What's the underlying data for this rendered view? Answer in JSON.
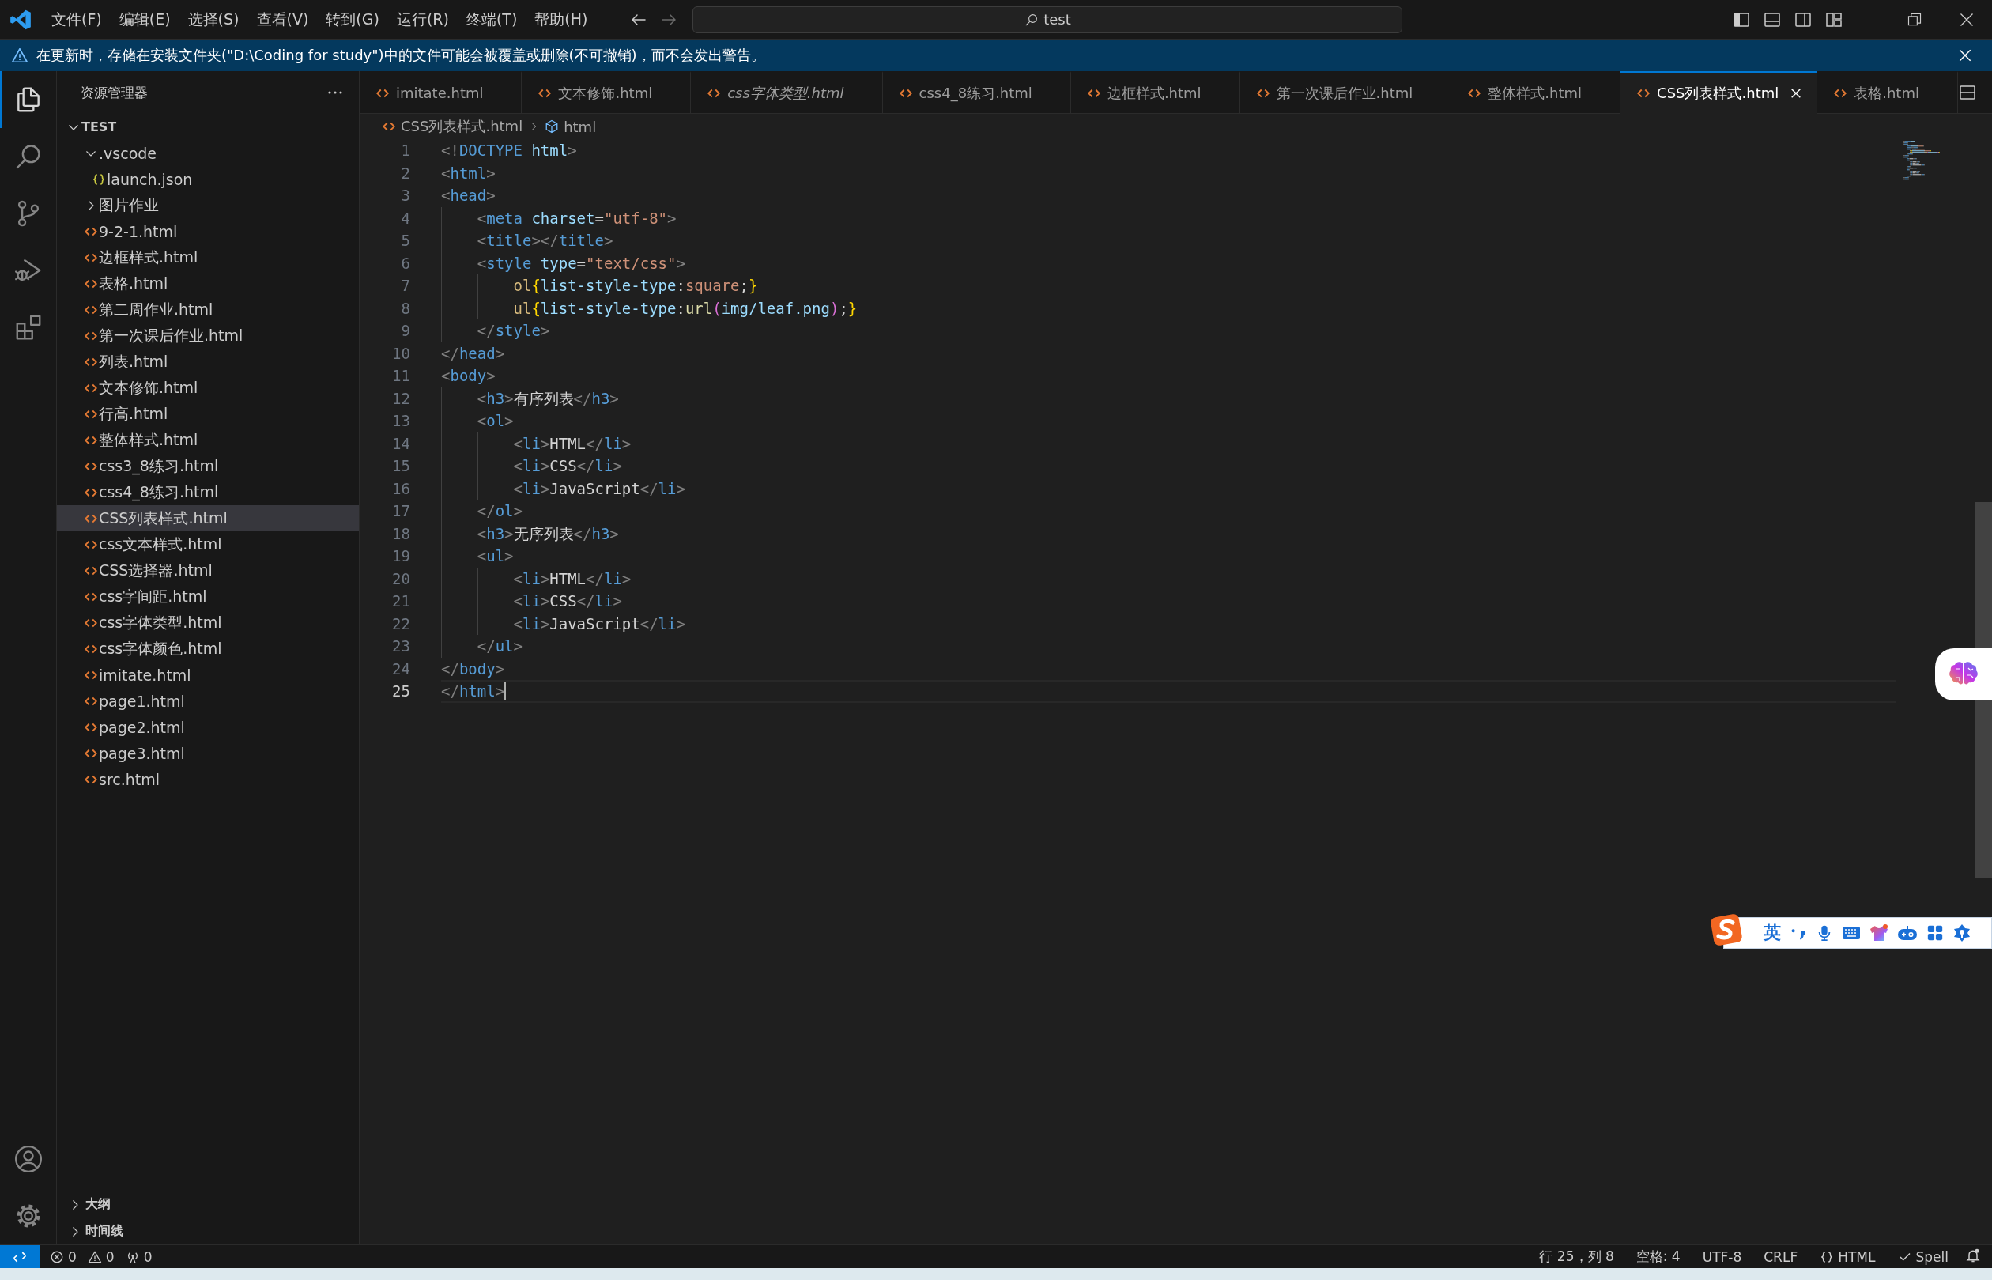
{
  "title_bar": {
    "menu": [
      "文件(F)",
      "编辑(E)",
      "选择(S)",
      "查看(V)",
      "转到(G)",
      "运行(R)",
      "终端(T)",
      "帮助(H)"
    ],
    "command_center": "test"
  },
  "notification": {
    "message": "在更新时，存储在安装文件夹(\"D:\\Coding for study\")中的文件可能会被覆盖或删除(不可撤销)，而不会发出警告。"
  },
  "activity_bar": {
    "top": [
      {
        "kind": "explorer",
        "selected": true
      },
      {
        "kind": "search",
        "selected": false
      },
      {
        "kind": "scm",
        "selected": false
      },
      {
        "kind": "debug",
        "selected": false
      },
      {
        "kind": "extensions",
        "selected": false
      }
    ],
    "bottom": [
      {
        "kind": "accounts"
      },
      {
        "kind": "manage"
      }
    ]
  },
  "explorer": {
    "title": "资源管理器",
    "root": {
      "label": "TEST",
      "expanded": true,
      "children": [
        {
          "label": ".vscode",
          "kind": "folder",
          "expanded": true,
          "selected": false,
          "children": [
            {
              "label": "launch.json",
              "kind": "json",
              "selected": false
            }
          ]
        },
        {
          "label": "图片作业",
          "kind": "folder",
          "expanded": false,
          "selected": false
        },
        {
          "label": "9-2-1.html",
          "kind": "html",
          "selected": false
        },
        {
          "label": "边框样式.html",
          "kind": "html",
          "selected": false
        },
        {
          "label": "表格.html",
          "kind": "html",
          "selected": false
        },
        {
          "label": "第二周作业.html",
          "kind": "html",
          "selected": false
        },
        {
          "label": "第一次课后作业.html",
          "kind": "html",
          "selected": false
        },
        {
          "label": "列表.html",
          "kind": "html",
          "selected": false
        },
        {
          "label": "文本修饰.html",
          "kind": "html",
          "selected": false
        },
        {
          "label": "行高.html",
          "kind": "html",
          "selected": false
        },
        {
          "label": "整体样式.html",
          "kind": "html",
          "selected": false
        },
        {
          "label": "css3_8练习.html",
          "kind": "html",
          "selected": false
        },
        {
          "label": "css4_8练习.html",
          "kind": "html",
          "selected": false
        },
        {
          "label": "CSS列表样式.html",
          "kind": "html",
          "selected": true
        },
        {
          "label": "css文本样式.html",
          "kind": "html",
          "selected": false
        },
        {
          "label": "CSS选择器.html",
          "kind": "html",
          "selected": false
        },
        {
          "label": "css字间距.html",
          "kind": "html",
          "selected": false
        },
        {
          "label": "css字体类型.html",
          "kind": "html",
          "selected": false
        },
        {
          "label": "css字体颜色.html",
          "kind": "html",
          "selected": false
        },
        {
          "label": "imitate.html",
          "kind": "html",
          "selected": false
        },
        {
          "label": "page1.html",
          "kind": "html",
          "selected": false
        },
        {
          "label": "page2.html",
          "kind": "html",
          "selected": false
        },
        {
          "label": "page3.html",
          "kind": "html",
          "selected": false
        },
        {
          "label": "src.html",
          "kind": "html",
          "selected": false
        }
      ]
    },
    "sections": [
      {
        "label": "大纲",
        "expanded": false
      },
      {
        "label": "时间线",
        "expanded": false
      }
    ]
  },
  "tabs": [
    {
      "label": "imitate.html",
      "selected": false,
      "preview": false
    },
    {
      "label": "文本修饰.html",
      "selected": false,
      "preview": false
    },
    {
      "label": "css字体类型.html",
      "selected": false,
      "preview": true
    },
    {
      "label": "css4_8练习.html",
      "selected": false,
      "preview": false
    },
    {
      "label": "边框样式.html",
      "selected": false,
      "preview": false
    },
    {
      "label": "第一次课后作业.html",
      "selected": false,
      "preview": false
    },
    {
      "label": "整体样式.html",
      "selected": false,
      "preview": false
    },
    {
      "label": "CSS列表样式.html",
      "selected": true,
      "preview": false
    },
    {
      "label": "表格.html",
      "selected": false,
      "preview": false
    }
  ],
  "breadcrumb": [
    "CSS列表样式.html",
    "html"
  ],
  "lines": [
    {
      "number": "1",
      "current": false,
      "tokens": [
        {
          "kind": "p",
          "text": "<!"
        },
        {
          "kind": "tag",
          "text": "DOCTYPE"
        },
        {
          "kind": "attr",
          "text": " html"
        },
        {
          "kind": "p",
          "text": ">"
        }
      ]
    },
    {
      "number": "2",
      "current": false,
      "tokens": [
        {
          "kind": "p",
          "text": "<"
        },
        {
          "kind": "tag",
          "text": "html"
        },
        {
          "kind": "p",
          "text": ">"
        }
      ]
    },
    {
      "number": "3",
      "current": false,
      "tokens": [
        {
          "kind": "p",
          "text": "<"
        },
        {
          "kind": "tag",
          "text": "head"
        },
        {
          "kind": "p",
          "text": ">"
        }
      ]
    },
    {
      "number": "4",
      "current": false,
      "tokens": [
        {
          "kind": "p",
          "text": "    <"
        },
        {
          "kind": "tag",
          "text": "meta"
        },
        {
          "kind": "attr",
          "text": " charset"
        },
        {
          "kind": "txt",
          "text": "="
        },
        {
          "kind": "str",
          "text": "\"utf-8\""
        },
        {
          "kind": "p",
          "text": ">"
        }
      ]
    },
    {
      "number": "5",
      "current": false,
      "tokens": [
        {
          "kind": "p",
          "text": "    <"
        },
        {
          "kind": "tag",
          "text": "title"
        },
        {
          "kind": "p",
          "text": "></"
        },
        {
          "kind": "tag",
          "text": "title"
        },
        {
          "kind": "p",
          "text": ">"
        }
      ]
    },
    {
      "number": "6",
      "current": false,
      "tokens": [
        {
          "kind": "p",
          "text": "    <"
        },
        {
          "kind": "tag",
          "text": "style"
        },
        {
          "kind": "attr",
          "text": " type"
        },
        {
          "kind": "txt",
          "text": "="
        },
        {
          "kind": "str",
          "text": "\"text/css\""
        },
        {
          "kind": "p",
          "text": ">"
        }
      ]
    },
    {
      "number": "7",
      "current": false,
      "tokens": [
        {
          "kind": "sel",
          "text": "        ol"
        },
        {
          "kind": "brace",
          "text": "{"
        },
        {
          "kind": "prop",
          "text": "list-style-type"
        },
        {
          "kind": "txt",
          "text": ":"
        },
        {
          "kind": "val",
          "text": "square"
        },
        {
          "kind": "txt",
          "text": ";"
        },
        {
          "kind": "brace",
          "text": "}"
        }
      ]
    },
    {
      "number": "8",
      "current": false,
      "tokens": [
        {
          "kind": "sel",
          "text": "        ul"
        },
        {
          "kind": "brace",
          "text": "{"
        },
        {
          "kind": "prop",
          "text": "list-style-type"
        },
        {
          "kind": "txt",
          "text": ":"
        },
        {
          "kind": "fn",
          "text": "url"
        },
        {
          "kind": "paren",
          "text": "("
        },
        {
          "kind": "prop",
          "text": "img/leaf.png"
        },
        {
          "kind": "paren",
          "text": ")"
        },
        {
          "kind": "txt",
          "text": ";"
        },
        {
          "kind": "brace",
          "text": "}"
        }
      ]
    },
    {
      "number": "9",
      "current": false,
      "tokens": [
        {
          "kind": "p",
          "text": "    </"
        },
        {
          "kind": "tag",
          "text": "style"
        },
        {
          "kind": "p",
          "text": ">"
        }
      ]
    },
    {
      "number": "10",
      "current": false,
      "tokens": [
        {
          "kind": "p",
          "text": "</"
        },
        {
          "kind": "tag",
          "text": "head"
        },
        {
          "kind": "p",
          "text": ">"
        }
      ]
    },
    {
      "number": "11",
      "current": false,
      "tokens": [
        {
          "kind": "p",
          "text": "<"
        },
        {
          "kind": "tag",
          "text": "body"
        },
        {
          "kind": "p",
          "text": ">"
        }
      ]
    },
    {
      "number": "12",
      "current": false,
      "tokens": [
        {
          "kind": "p",
          "text": "    <"
        },
        {
          "kind": "tag",
          "text": "h3"
        },
        {
          "kind": "p",
          "text": ">"
        },
        {
          "kind": "txt",
          "text": "有序列表"
        },
        {
          "kind": "p",
          "text": "</"
        },
        {
          "kind": "tag",
          "text": "h3"
        },
        {
          "kind": "p",
          "text": ">"
        }
      ]
    },
    {
      "number": "13",
      "current": false,
      "tokens": [
        {
          "kind": "p",
          "text": "    <"
        },
        {
          "kind": "tag",
          "text": "ol"
        },
        {
          "kind": "p",
          "text": ">"
        }
      ]
    },
    {
      "number": "14",
      "current": false,
      "tokens": [
        {
          "kind": "p",
          "text": "        <"
        },
        {
          "kind": "tag",
          "text": "li"
        },
        {
          "kind": "p",
          "text": ">"
        },
        {
          "kind": "txt",
          "text": "HTML"
        },
        {
          "kind": "p",
          "text": "</"
        },
        {
          "kind": "tag",
          "text": "li"
        },
        {
          "kind": "p",
          "text": ">"
        }
      ]
    },
    {
      "number": "15",
      "current": false,
      "tokens": [
        {
          "kind": "p",
          "text": "        <"
        },
        {
          "kind": "tag",
          "text": "li"
        },
        {
          "kind": "p",
          "text": ">"
        },
        {
          "kind": "txt",
          "text": "CSS"
        },
        {
          "kind": "p",
          "text": "</"
        },
        {
          "kind": "tag",
          "text": "li"
        },
        {
          "kind": "p",
          "text": ">"
        }
      ]
    },
    {
      "number": "16",
      "current": false,
      "tokens": [
        {
          "kind": "p",
          "text": "        <"
        },
        {
          "kind": "tag",
          "text": "li"
        },
        {
          "kind": "p",
          "text": ">"
        },
        {
          "kind": "txt",
          "text": "JavaScript"
        },
        {
          "kind": "p",
          "text": "</"
        },
        {
          "kind": "tag",
          "text": "li"
        },
        {
          "kind": "p",
          "text": ">"
        }
      ]
    },
    {
      "number": "17",
      "current": false,
      "tokens": [
        {
          "kind": "p",
          "text": "    </"
        },
        {
          "kind": "tag",
          "text": "ol"
        },
        {
          "kind": "p",
          "text": ">"
        }
      ]
    },
    {
      "number": "18",
      "current": false,
      "tokens": [
        {
          "kind": "p",
          "text": "    <"
        },
        {
          "kind": "tag",
          "text": "h3"
        },
        {
          "kind": "p",
          "text": ">"
        },
        {
          "kind": "txt",
          "text": "无序列表"
        },
        {
          "kind": "p",
          "text": "</"
        },
        {
          "kind": "tag",
          "text": "h3"
        },
        {
          "kind": "p",
          "text": ">"
        }
      ]
    },
    {
      "number": "19",
      "current": false,
      "tokens": [
        {
          "kind": "p",
          "text": "    <"
        },
        {
          "kind": "tag",
          "text": "ul"
        },
        {
          "kind": "p",
          "text": ">"
        }
      ]
    },
    {
      "number": "20",
      "current": false,
      "tokens": [
        {
          "kind": "p",
          "text": "        <"
        },
        {
          "kind": "tag",
          "text": "li"
        },
        {
          "kind": "p",
          "text": ">"
        },
        {
          "kind": "txt",
          "text": "HTML"
        },
        {
          "kind": "p",
          "text": "</"
        },
        {
          "kind": "tag",
          "text": "li"
        },
        {
          "kind": "p",
          "text": ">"
        }
      ]
    },
    {
      "number": "21",
      "current": false,
      "tokens": [
        {
          "kind": "p",
          "text": "        <"
        },
        {
          "kind": "tag",
          "text": "li"
        },
        {
          "kind": "p",
          "text": ">"
        },
        {
          "kind": "txt",
          "text": "CSS"
        },
        {
          "kind": "p",
          "text": "</"
        },
        {
          "kind": "tag",
          "text": "li"
        },
        {
          "kind": "p",
          "text": ">"
        }
      ]
    },
    {
      "number": "22",
      "current": false,
      "tokens": [
        {
          "kind": "p",
          "text": "        <"
        },
        {
          "kind": "tag",
          "text": "li"
        },
        {
          "kind": "p",
          "text": ">"
        },
        {
          "kind": "txt",
          "text": "JavaScript"
        },
        {
          "kind": "p",
          "text": "</"
        },
        {
          "kind": "tag",
          "text": "li"
        },
        {
          "kind": "p",
          "text": ">"
        }
      ]
    },
    {
      "number": "23",
      "current": false,
      "tokens": [
        {
          "kind": "p",
          "text": "    </"
        },
        {
          "kind": "tag",
          "text": "ul"
        },
        {
          "kind": "p",
          "text": ">"
        }
      ]
    },
    {
      "number": "24",
      "current": false,
      "tokens": [
        {
          "kind": "p",
          "text": "</"
        },
        {
          "kind": "tag",
          "text": "body"
        },
        {
          "kind": "p",
          "text": ">"
        }
      ]
    },
    {
      "number": "25",
      "current": true,
      "tokens": [
        {
          "kind": "p",
          "text": "</"
        },
        {
          "kind": "tag",
          "text": "html"
        },
        {
          "kind": "p",
          "text": ">"
        }
      ]
    }
  ],
  "ime_toolbar": {
    "mode": "英"
  },
  "status_bar": {
    "left": [
      {
        "kind": "remote"
      },
      {
        "kind": "errors",
        "text": "0"
      },
      {
        "kind": "warnings",
        "text": "0"
      },
      {
        "kind": "ports",
        "text": "0"
      }
    ],
    "right": [
      {
        "kind": "plain",
        "text": "行 25，列 8"
      },
      {
        "kind": "plain",
        "text": "空格: 4"
      },
      {
        "kind": "plain",
        "text": "UTF-8"
      },
      {
        "kind": "plain",
        "text": "CRLF"
      },
      {
        "kind": "language",
        "text": "HTML"
      },
      {
        "kind": "spell",
        "text": "Spell"
      },
      {
        "kind": "bell"
      }
    ]
  }
}
